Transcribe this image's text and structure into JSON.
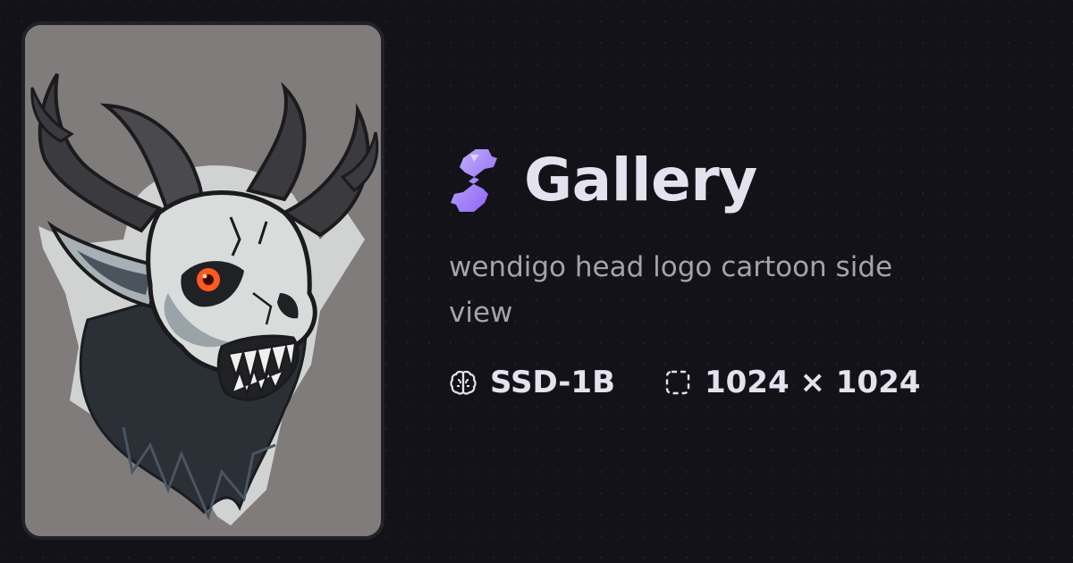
{
  "header": {
    "title": "Gallery",
    "logo_icon": "gallery-logo-icon",
    "accent_color": "#a78bfa"
  },
  "prompt": {
    "text": "wendigo head logo cartoon side view"
  },
  "meta": {
    "model": {
      "icon": "brain-icon",
      "label": "SSD-1B"
    },
    "dimensions": {
      "icon": "dashed-square-icon",
      "label": "1024 × 1024"
    }
  },
  "image": {
    "subject": "wendigo-head-illustration"
  },
  "colors": {
    "background": "#131218",
    "title_text": "#e4e2ee",
    "muted_text": "#a4a2ad",
    "image_background": "#7e7b7a"
  }
}
